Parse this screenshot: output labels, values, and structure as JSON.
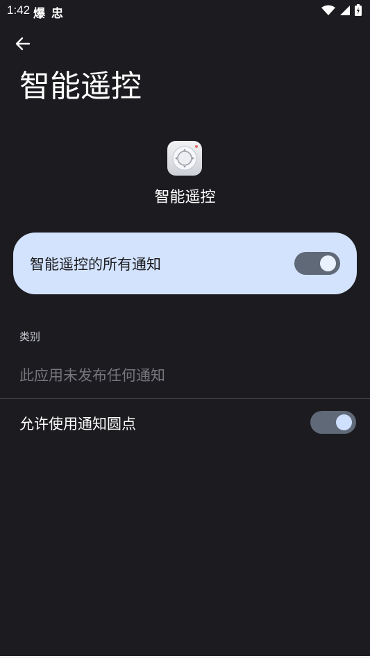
{
  "status_bar": {
    "time": "1:42",
    "notification_icons": [
      "爆",
      "忠"
    ]
  },
  "header": {
    "back_icon": "arrow-left-icon",
    "title": "智能遥控"
  },
  "app": {
    "icon": "remote-control-app-icon",
    "name": "智能遥控"
  },
  "master_toggle": {
    "label": "智能遥控的所有通知",
    "enabled": true
  },
  "categories": {
    "header": "类别",
    "empty_message": "此应用未发布任何通知"
  },
  "notification_dots": {
    "label": "允许使用通知圆点",
    "enabled": true
  },
  "colors": {
    "background": "#1c1b1f",
    "card": "#d3e3fd",
    "toggle_track": "#5f6978"
  }
}
